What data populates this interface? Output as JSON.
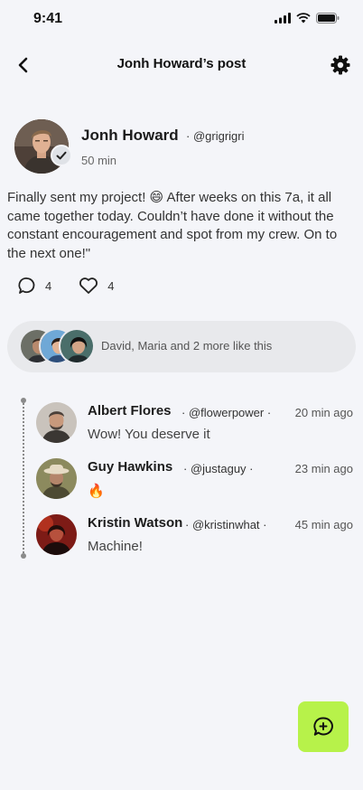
{
  "status_bar": {
    "time": "9:41"
  },
  "header": {
    "title": "Jonh Howard’s post"
  },
  "post": {
    "author_name": "Jonh Howard",
    "author_handle": "· @grigrigri",
    "time": "50 min",
    "text": "Finally sent my project! 😄 After weeks on this 7a, it all came together today. Couldn’t have done it without the constant encouragement and spot from my crew. On to the next one!\"",
    "comments_count": "4",
    "likes_count": "4"
  },
  "likes_summary": {
    "text": "David, Maria and 2 more like this"
  },
  "comments": [
    {
      "name": "Albert Flores",
      "handle": "· @flowerpower ·",
      "time": "20 min ago",
      "text": "Wow! You deserve it"
    },
    {
      "name": "Guy Hawkins",
      "handle": "· @justaguy ·",
      "time": "23 min ago",
      "text": "🔥"
    },
    {
      "name": "Kristin Watson",
      "handle": "· @kristinwhat ·",
      "time": "45 min ago",
      "text": "Machine!"
    }
  ],
  "colors": {
    "background": "#f4f5f9",
    "accent": "#b7f24a",
    "likes_bar": "#e8e9ec"
  },
  "icons": [
    "signal-icon",
    "wifi-icon",
    "battery-icon",
    "back-arrow-icon",
    "settings-gear-icon",
    "verified-check-icon",
    "comment-bubble-icon",
    "heart-icon",
    "add-comment-icon"
  ]
}
